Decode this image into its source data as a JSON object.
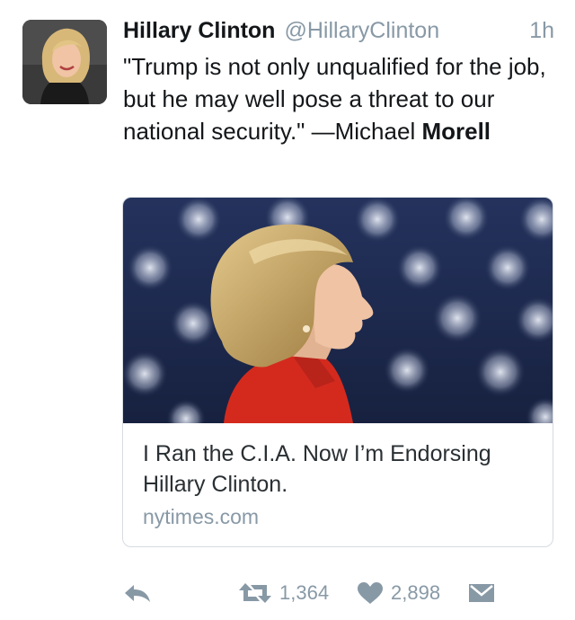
{
  "tweet": {
    "author_name": "Hillary Clinton",
    "author_handle": "@HillaryClinton",
    "time": "1h",
    "text_main": "\"Trump is not only unqualified for the job, but he may well pose a threat to our national security.\" —Michael ",
    "text_bold": "Morell"
  },
  "card": {
    "title": "I Ran the C.I.A. Now I’m Endorsing Hillary Clinton.",
    "domain": "nytimes.com"
  },
  "actions": {
    "retweet_count": "1,364",
    "like_count": "2,898",
    "icons": [
      "reply-icon",
      "retweet-icon",
      "heart-icon",
      "message-icon"
    ]
  },
  "colors": {
    "muted": "#8899a6",
    "card_border": "#d6dbe0",
    "flag_navy": "#1f2c52",
    "shirt_red": "#d42a1e"
  }
}
